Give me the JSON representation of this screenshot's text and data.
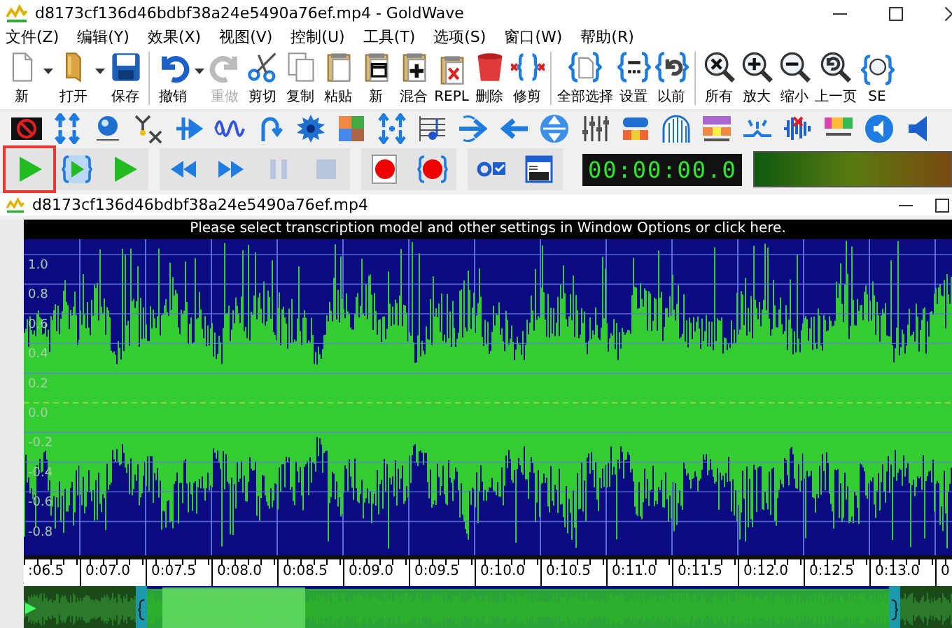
{
  "window": {
    "title": "d8173cf136d46bdbf38a24e5490a76ef.mp4 - GoldWave"
  },
  "menu": [
    "文件(Z)",
    "编辑(Y)",
    "效果(X)",
    "视图(V)",
    "控制(U)",
    "工具(T)",
    "选项(S)",
    "窗口(W)",
    "帮助(R)"
  ],
  "toolbar": {
    "groups": [
      [
        {
          "kind": "button",
          "label": "新",
          "disabled": false
        },
        {
          "kind": "dropdown"
        },
        {
          "kind": "button",
          "label": "打开",
          "disabled": false
        },
        {
          "kind": "dropdown"
        },
        {
          "kind": "button",
          "label": "保存",
          "disabled": false
        }
      ],
      [
        {
          "kind": "button",
          "label": "撤销",
          "disabled": false
        },
        {
          "kind": "dropdown"
        },
        {
          "kind": "button",
          "label": "重做",
          "disabled": true
        },
        {
          "kind": "button",
          "label": "剪切",
          "disabled": false
        },
        {
          "kind": "button",
          "label": "复制",
          "disabled": false
        },
        {
          "kind": "button",
          "label": "粘贴",
          "disabled": false
        },
        {
          "kind": "button",
          "label": "新",
          "disabled": false
        },
        {
          "kind": "button",
          "label": "混合",
          "disabled": false
        },
        {
          "kind": "button",
          "label": "REPL",
          "disabled": false
        },
        {
          "kind": "button",
          "label": "删除",
          "disabled": false
        },
        {
          "kind": "button",
          "label": "修剪",
          "disabled": false
        }
      ],
      [
        {
          "kind": "button",
          "label": "全部选择",
          "disabled": false
        },
        {
          "kind": "button",
          "label": "设置",
          "disabled": false
        },
        {
          "kind": "button",
          "label": "以前",
          "disabled": false
        }
      ],
      [
        {
          "kind": "button",
          "label": "所有",
          "disabled": false
        },
        {
          "kind": "button",
          "label": "放大",
          "disabled": false
        },
        {
          "kind": "button",
          "label": "缩小",
          "disabled": false
        },
        {
          "kind": "button",
          "label": "上一页",
          "disabled": false
        },
        {
          "kind": "button",
          "label": "SE",
          "disabled": false
        }
      ]
    ]
  },
  "transport": {
    "groups": [
      [
        {
          "kind": "play",
          "disabled": false,
          "highlighted": true
        },
        {
          "kind": "play-selection",
          "disabled": false,
          "highlighted": false
        },
        {
          "kind": "play",
          "disabled": false,
          "highlighted": false
        }
      ],
      [
        {
          "kind": "rewind",
          "disabled": false,
          "highlighted": false
        },
        {
          "kind": "fast-forward",
          "disabled": false,
          "highlighted": false
        },
        {
          "kind": "pause",
          "disabled": true,
          "highlighted": false
        },
        {
          "kind": "stop",
          "disabled": true,
          "highlighted": false
        }
      ],
      [
        {
          "kind": "record",
          "disabled": false,
          "highlighted": false
        },
        {
          "kind": "record-selection",
          "disabled": false,
          "highlighted": false
        }
      ],
      [
        {
          "kind": "record-options",
          "disabled": false,
          "highlighted": false
        },
        {
          "kind": "window-view",
          "disabled": false,
          "highlighted": false
        }
      ]
    ],
    "time": "00:00:00.0"
  },
  "document": {
    "title": "d8173cf136d46bdbf38a24e5490a76ef.mp4",
    "banner": "Please select transcription model and other settings in Window Options or click here.",
    "y_axis": [
      "1.0",
      "0.8",
      "0.6",
      "0.4",
      "0.2",
      "0.0",
      "-0.2",
      "-0.4",
      "-0.6",
      "-0.8"
    ],
    "time_axis": [
      ":06.5",
      "0:07.0",
      "0:07.5",
      "0:08.0",
      "0:08.5",
      "0:09.0",
      "0:09.5",
      "0:10.0",
      "0:10.5",
      "0:11.0",
      "0:11.5",
      "0:12.0",
      "0:12.5",
      "0:13.0",
      "0"
    ]
  }
}
